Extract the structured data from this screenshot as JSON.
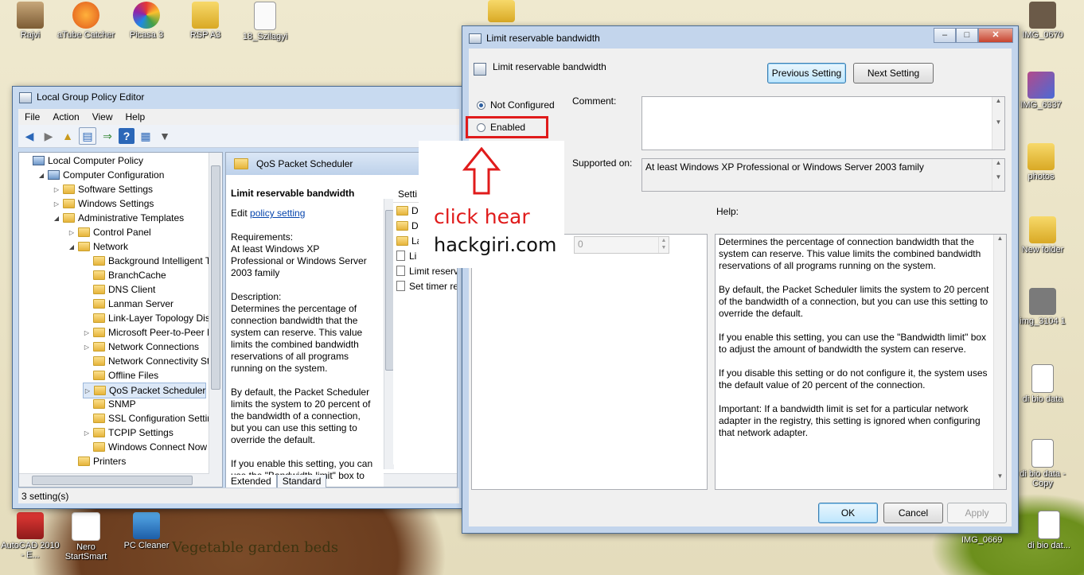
{
  "desktop": {
    "icons_left": [
      {
        "label": "Rajvi"
      },
      {
        "label": "aTube Catcher"
      },
      {
        "label": "Picasa 3"
      },
      {
        "label": "RSP A3"
      },
      {
        "label": "18_Szilagyi"
      }
    ],
    "icons_right": [
      {
        "label": "IMG_0670"
      },
      {
        "label": "IMG_6337"
      },
      {
        "label": "photos"
      },
      {
        "label": "New folder"
      },
      {
        "label": "img_3104 1"
      },
      {
        "label": "di bio data"
      },
      {
        "label": "di bio data - Copy"
      },
      {
        "label": "di bio dat..."
      }
    ],
    "icons_bottom": [
      {
        "label": "AutoCAD 2010 - E..."
      },
      {
        "label": "Nero StartSmart"
      },
      {
        "label": "PC Cleaner"
      }
    ],
    "bottom_partial_label": "IMG_0669",
    "caption": "Vegetable garden beds"
  },
  "gpe": {
    "title": "Local Group Policy Editor",
    "menu": [
      "File",
      "Action",
      "View",
      "Help"
    ],
    "tree": [
      {
        "label": "Local Computer Policy",
        "level": 0,
        "twisty": "",
        "icon": "pc"
      },
      {
        "label": "Computer Configuration",
        "level": 1,
        "twisty": "open",
        "icon": "pc"
      },
      {
        "label": "Software Settings",
        "level": 2,
        "twisty": "closed",
        "icon": "folder"
      },
      {
        "label": "Windows Settings",
        "level": 2,
        "twisty": "closed",
        "icon": "folder"
      },
      {
        "label": "Administrative Templates",
        "level": 2,
        "twisty": "open",
        "icon": "folder"
      },
      {
        "label": "Control Panel",
        "level": 3,
        "twisty": "closed",
        "icon": "folder"
      },
      {
        "label": "Network",
        "level": 3,
        "twisty": "open",
        "icon": "folder"
      },
      {
        "label": "Background Intelligent Tr",
        "level": 4,
        "twisty": "",
        "icon": "folder"
      },
      {
        "label": "BranchCache",
        "level": 4,
        "twisty": "",
        "icon": "folder"
      },
      {
        "label": "DNS Client",
        "level": 4,
        "twisty": "",
        "icon": "folder"
      },
      {
        "label": "Lanman Server",
        "level": 4,
        "twisty": "",
        "icon": "folder"
      },
      {
        "label": "Link-Layer Topology Disc",
        "level": 4,
        "twisty": "",
        "icon": "folder"
      },
      {
        "label": "Microsoft Peer-to-Peer Ne",
        "level": 4,
        "twisty": "closed",
        "icon": "folder"
      },
      {
        "label": "Network Connections",
        "level": 4,
        "twisty": "closed",
        "icon": "folder"
      },
      {
        "label": "Network Connectivity Stat",
        "level": 4,
        "twisty": "",
        "icon": "folder"
      },
      {
        "label": "Offline Files",
        "level": 4,
        "twisty": "",
        "icon": "folder"
      },
      {
        "label": "QoS Packet Scheduler",
        "level": 4,
        "twisty": "closed",
        "icon": "folder",
        "selected": true
      },
      {
        "label": "SNMP",
        "level": 4,
        "twisty": "",
        "icon": "folder"
      },
      {
        "label": "SSL Configuration Setting",
        "level": 4,
        "twisty": "",
        "icon": "folder"
      },
      {
        "label": "TCPIP Settings",
        "level": 4,
        "twisty": "closed",
        "icon": "folder"
      },
      {
        "label": "Windows Connect Now",
        "level": 4,
        "twisty": "",
        "icon": "folder"
      },
      {
        "label": "Printers",
        "level": 3,
        "twisty": "",
        "icon": "folder"
      }
    ],
    "pane_header": "QoS Packet Scheduler",
    "desc": {
      "heading": "Limit reservable bandwidth",
      "edit_prefix": "Edit ",
      "edit_link": "policy setting",
      "requirements": "Requirements:",
      "requirements_text": "At least Windows XP Professional or Windows Server 2003 family",
      "description_label": "Description:",
      "description_text": "Determines the percentage of connection bandwidth that the system can reserve. This value limits the combined bandwidth reservations of all programs running on the system.",
      "default_text": "By default, the Packet Scheduler limits the system to 20 percent of the bandwidth of a connection, but you can use this setting to override the default.",
      "enable_text": "If you enable this setting, you can use the \"Bandwidth limit\" box to"
    },
    "list_header": "Setti",
    "list_items": [
      "D",
      "D",
      "La",
      "Li",
      "Limit reserv",
      "Set timer res"
    ],
    "tabs": [
      "Extended",
      "Standard"
    ],
    "status": "3 setting(s)"
  },
  "dialog": {
    "title": "Limit reservable bandwidth",
    "header": "Limit reservable bandwidth",
    "prev_button": "Previous Setting",
    "next_button": "Next Setting",
    "radio_not_configured": "Not Configured",
    "radio_enabled": "Enabled",
    "comment_label": "Comment:",
    "supported_label": "Supported on:",
    "supported_text": "At least Windows XP Professional or Windows Server 2003 family",
    "help_label": "Help:",
    "bandwidth_value": "0",
    "help_paragraphs": [
      "Determines the percentage of connection bandwidth that the system can reserve. This value limits the combined bandwidth reservations of all programs running on the system.",
      "By default, the Packet Scheduler limits the system to 20 percent of the bandwidth of a connection, but you can use this setting to override the default.",
      "If you enable this setting, you can use the \"Bandwidth limit\" box to adjust the amount of bandwidth the system can reserve.",
      "If you disable this setting or do not configure it, the system uses the default value of 20 percent of the connection.",
      "Important: If a bandwidth limit is set for a particular network adapter in the registry, this setting is ignored when configuring that network adapter."
    ],
    "ok": "OK",
    "cancel": "Cancel",
    "apply": "Apply"
  },
  "annotation": {
    "click_text": "click hear",
    "site_text": "hackgiri.com"
  },
  "colors": {
    "annotation_red": "#e01b1b",
    "link_blue": "#0645ad",
    "selection": "#dce8f7"
  }
}
